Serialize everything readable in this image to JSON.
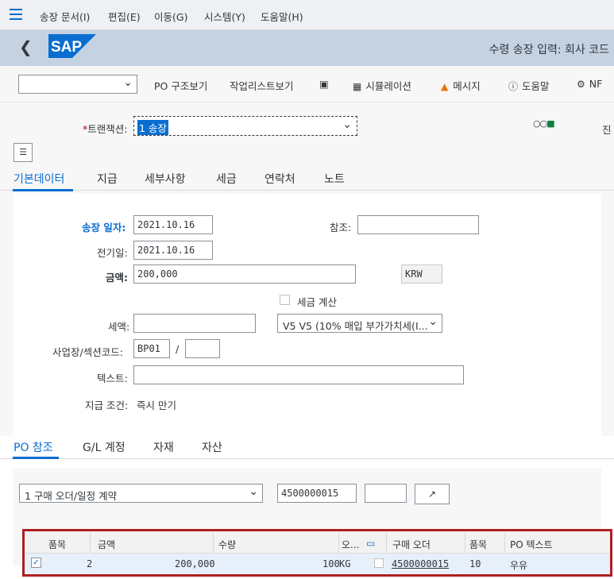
{
  "menubar": {
    "items": [
      "송장 문서(I)",
      "편집(E)",
      "이동(G)",
      "시스템(Y)",
      "도움말(H)"
    ]
  },
  "header": {
    "back_icon": "chevron-left-icon",
    "logo_text": "SAP",
    "title": "수령 송장 입력: 회사 코드"
  },
  "toolbar": {
    "dropdown_value": "",
    "po_structure": "PO 구조보기",
    "worklist": "작업리스트보기",
    "simulation": "시뮬레이션",
    "message": "메시지",
    "help": "도움말",
    "nf": "NF"
  },
  "transaction": {
    "label": "트랜잭션:",
    "value": "1 송장",
    "cut_text": "진"
  },
  "tabs_main": [
    "기본데이터",
    "지급",
    "세부사항",
    "세금",
    "연락처",
    "노트"
  ],
  "form": {
    "invoice_date_label": "송장 일자:",
    "invoice_date": "2021.10.16",
    "reference_label": "참조:",
    "reference": "",
    "posting_date_label": "전기일:",
    "posting_date": "2021.10.16",
    "amount_label": "금액:",
    "amount": "200,000",
    "currency": "KRW",
    "calc_tax_label": "세금 계산",
    "tax_amount_label": "세액:",
    "tax_amount": "",
    "tax_code": "V5 V5 (10% 매입 부가가치세(I...",
    "bp_label": "사업장/섹션코드:",
    "bp_code": "BP01",
    "bp_sep": "/",
    "section_code": "",
    "text_label": "텍스트:",
    "text": "",
    "payment_terms_label": "지급 조건:",
    "payment_terms": "즉시 만기"
  },
  "tabs_lower": [
    "PO 참조",
    "G/L 계정",
    "자재",
    "자산"
  ],
  "lower": {
    "ref_type": "1 구매 오더/일정 계약",
    "po_number": "4500000015",
    "item": ""
  },
  "grid": {
    "headers": [
      "품목",
      "금액",
      "수량",
      "오...",
      "구매 오더",
      "품목",
      "PO 텍스트"
    ],
    "row": {
      "item": "2",
      "amount": "200,000",
      "quantity": "100",
      "unit": "KG",
      "po": "4500000015",
      "po_item": "10",
      "po_text": "우유"
    }
  },
  "colors": {
    "accent": "#0a6ed1",
    "header_bg": "#c5d2e2",
    "warning": "#e9730c",
    "highlight_frame": "#b01e1e"
  }
}
